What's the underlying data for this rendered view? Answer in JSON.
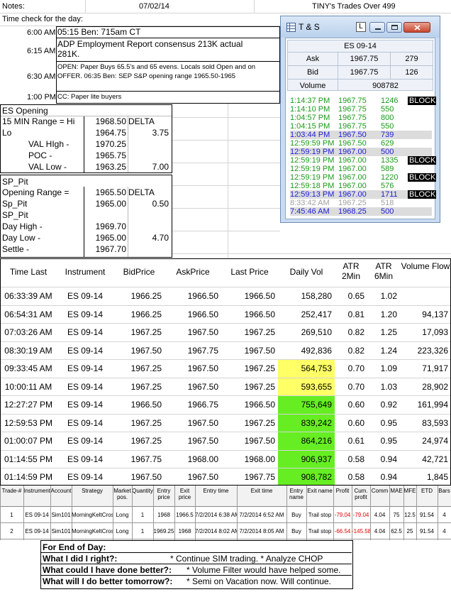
{
  "header": {
    "notes_label": "Notes:",
    "date": "07/02/14",
    "trades_title": "TINY's Trades Over 499"
  },
  "time_check": {
    "title": "Time check for the day:",
    "entries": [
      {
        "time": "6:00 AM",
        "text": "05:15 Ben: 715am CT"
      },
      {
        "time": "6:15 AM",
        "text": "ADP Employment Report consensus 213K actual 281K."
      },
      {
        "time": "6:30 AM",
        "text": "OPEN: Paper Buys 65.5's and 65 evens. Locals sold Open and on OFFER.  06:35 Ben: SEP S&P opening range 1965.50-1965"
      },
      {
        "time": "1:00 PM",
        "text": "CC: Paper lite buyers"
      }
    ]
  },
  "es_opening": {
    "title": "ES Opening",
    "rows": [
      {
        "label": "15 MIN Range = Hi",
        "value": "1968.50",
        "extra": "DELTA"
      },
      {
        "label": "Lo",
        "value": "1964.75",
        "extra": "3.75"
      },
      {
        "label": "VAL HIgh   -",
        "value": "1970.25",
        "extra": ""
      },
      {
        "label": "POC   -",
        "value": "1965.75",
        "extra": ""
      },
      {
        "label": "VAL Low   -",
        "value": "1963.25",
        "extra": "7.00"
      }
    ]
  },
  "sp_pit": {
    "rows": [
      {
        "label": "SP_Pit",
        "value": "",
        "extra": ""
      },
      {
        "label": "Opening Range =",
        "value": "1965.50",
        "extra": "DELTA"
      },
      {
        "label": "Sp_Pit",
        "value": "1965.00",
        "extra": "0.50"
      },
      {
        "label": "SP_Pit",
        "value": "",
        "extra": ""
      },
      {
        "label": "Day High -",
        "value": "1969.70",
        "extra": ""
      },
      {
        "label": "Day Low -",
        "value": "1965.00",
        "extra": "4.70"
      },
      {
        "label": "Settle -",
        "value": "1967.70",
        "extra": ""
      }
    ]
  },
  "ts_window": {
    "title": "T & S",
    "btn_l": "L",
    "instrument": "ES 09-14",
    "ask_label": "Ask",
    "ask_price": "1967.75",
    "ask_size": "279",
    "bid_label": "Bid",
    "bid_price": "1967.75",
    "bid_size": "126",
    "volume_label": "Volume",
    "volume": "908782",
    "colors": {
      "green": "#1a9a1a",
      "blue": "#1c1cd6",
      "gray": "#a0a0a0",
      "row_hl": "#dcdcdc"
    },
    "rows": [
      {
        "time": "1:14:37 PM",
        "price": "1967.75",
        "size": "1246",
        "block": "BLOCK",
        "color": "green",
        "hl": false
      },
      {
        "time": "1:14:10 PM",
        "price": "1967.75",
        "size": "550",
        "block": "",
        "color": "green",
        "hl": false
      },
      {
        "time": "1:04:57 PM",
        "price": "1967.75",
        "size": "800",
        "block": "",
        "color": "green",
        "hl": false
      },
      {
        "time": "1:04:15 PM",
        "price": "1967.75",
        "size": "550",
        "block": "",
        "color": "green",
        "hl": false
      },
      {
        "time": "1:03:44 PM",
        "price": "1967.50",
        "size": "739",
        "block": "",
        "color": "blue",
        "hl": true
      },
      {
        "time": "12:59:59 PM",
        "price": "1967.50",
        "size": "629",
        "block": "",
        "color": "green",
        "hl": false
      },
      {
        "time": "12:59:19 PM",
        "price": "1967.00",
        "size": "500",
        "block": "",
        "color": "blue",
        "hl": true
      },
      {
        "time": "12:59:19 PM",
        "price": "1967.00",
        "size": "1335",
        "block": "BLOCK",
        "color": "green",
        "hl": false
      },
      {
        "time": "12:59:19 PM",
        "price": "1967.00",
        "size": "589",
        "block": "",
        "color": "green",
        "hl": false
      },
      {
        "time": "12:59:19 PM",
        "price": "1967.00",
        "size": "1220",
        "block": "BLOCK",
        "color": "green",
        "hl": false
      },
      {
        "time": "12:59:18 PM",
        "price": "1967.00",
        "size": "576",
        "block": "",
        "color": "green",
        "hl": false
      },
      {
        "time": "12:59:13 PM",
        "price": "1967.00",
        "size": "1711",
        "block": "BLOCK",
        "color": "blue",
        "hl": true
      },
      {
        "time": "8:33:42 AM",
        "price": "1967.25",
        "size": "518",
        "block": "",
        "color": "gray",
        "hl": false
      },
      {
        "time": "7:45:46 AM",
        "price": "1968.25",
        "size": "500",
        "block": "",
        "color": "blue",
        "hl": true
      }
    ]
  },
  "market_table": {
    "headers": [
      "Time Last",
      "Instrument",
      "BidPrice",
      "AskPrice",
      "Last Price",
      "Daily Vol",
      "ATR 2Min",
      "ATR 6Min",
      "Volume Flow"
    ],
    "highlight_colors": {
      "yellow": "#ffff66",
      "green": "#66ee22"
    },
    "rows": [
      {
        "time": "06:33:39 AM",
        "inst": "ES 09-14",
        "bid": "1966.25",
        "ask": "1966.50",
        "last": "1966.50",
        "vol": "158,280",
        "atr2": "0.65",
        "atr6": "1.02",
        "flow": "",
        "hl": ""
      },
      {
        "time": "06:54:31 AM",
        "inst": "ES 09-14",
        "bid": "1966.25",
        "ask": "1966.50",
        "last": "1966.50",
        "vol": "252,417",
        "atr2": "0.81",
        "atr6": "1.20",
        "flow": "94,137",
        "hl": ""
      },
      {
        "time": "07:03:26 AM",
        "inst": "ES 09-14",
        "bid": "1967.25",
        "ask": "1967.50",
        "last": "1967.25",
        "vol": "269,510",
        "atr2": "0.82",
        "atr6": "1.25",
        "flow": "17,093",
        "hl": ""
      },
      {
        "time": "08:30:19 AM",
        "inst": "ES 09-14",
        "bid": "1967.50",
        "ask": "1967.75",
        "last": "1967.50",
        "vol": "492,836",
        "atr2": "0.82",
        "atr6": "1.24",
        "flow": "223,326",
        "hl": ""
      },
      {
        "time": "09:33:45 AM",
        "inst": "ES 09-14",
        "bid": "1967.25",
        "ask": "1967.50",
        "last": "1967.25",
        "vol": "564,753",
        "atr2": "0.70",
        "atr6": "1.09",
        "flow": "71,917",
        "hl": "yellow"
      },
      {
        "time": "10:00:11 AM",
        "inst": "ES 09-14",
        "bid": "1967.25",
        "ask": "1967.50",
        "last": "1967.25",
        "vol": "593,655",
        "atr2": "0.70",
        "atr6": "1.03",
        "flow": "28,902",
        "hl": "yellow"
      },
      {
        "time": "12:27:27 PM",
        "inst": "ES 09-14",
        "bid": "1966.50",
        "ask": "1966.75",
        "last": "1966.50",
        "vol": "755,649",
        "atr2": "0.60",
        "atr6": "0.92",
        "flow": "161,994",
        "hl": "green"
      },
      {
        "time": "12:59:53 PM",
        "inst": "ES 09-14",
        "bid": "1967.25",
        "ask": "1967.50",
        "last": "1967.25",
        "vol": "839,242",
        "atr2": "0.60",
        "atr6": "0.95",
        "flow": "83,593",
        "hl": "green"
      },
      {
        "time": "01:00:07 PM",
        "inst": "ES 09-14",
        "bid": "1967.25",
        "ask": "1967.50",
        "last": "1967.50",
        "vol": "864,216",
        "atr2": "0.61",
        "atr6": "0.95",
        "flow": "24,974",
        "hl": "green"
      },
      {
        "time": "01:14:55 PM",
        "inst": "ES 09-14",
        "bid": "1967.75",
        "ask": "1968.00",
        "last": "1968.00",
        "vol": "906,937",
        "atr2": "0.58",
        "atr6": "0.94",
        "flow": "42,721",
        "hl": "green"
      },
      {
        "time": "01:14:59 PM",
        "inst": "ES 09-14",
        "bid": "1967.50",
        "ask": "1967.50",
        "last": "1967.75",
        "vol": "908,782",
        "atr2": "0.58",
        "atr6": "0.94",
        "flow": "1,845",
        "hl": "green"
      }
    ]
  },
  "trades": {
    "headers": [
      "Trade-#",
      "Instrument",
      "Account",
      "Strategy",
      "Market pos.",
      "Quantity",
      "Entry price",
      "Exit price",
      "Entry time",
      "Exit time",
      "Entry name",
      "Exit name",
      "Profit",
      "Cum. profit",
      "Comm",
      "MAE",
      "MFE",
      "ETD",
      "Bars"
    ],
    "loss_color": "#dd0000",
    "rows": [
      [
        "1",
        "ES 09-14",
        "Sim101",
        "MorningKeltCross",
        "Long",
        "1",
        "1968",
        "1966.5",
        "7/2/2014 6:38 AM",
        "7/2/2014 6:52 AM",
        "Buy",
        "Trail stop",
        "-79.04",
        "-79.04",
        "4.04",
        "75",
        "12.5",
        "91.54",
        "4"
      ],
      [
        "2",
        "ES 09-14",
        "Sim101",
        "MorningKeltCross",
        "Long",
        "1",
        "1969.25",
        "1968",
        "7/2/2014 8:02 AM",
        "7/2/2014 8:05 AM",
        "Buy",
        "Trail stop",
        "-66.54",
        "-145.58",
        "4.04",
        "62.5",
        "25",
        "91.54",
        "4"
      ]
    ]
  },
  "summary": {
    "title": "For End of Day:",
    "lines": [
      {
        "q": "What I did I right?:",
        "a": "* Continue SIM trading.  * Analyze CHOP"
      },
      {
        "q": "What could I have done better?:",
        "a": "* Volume Filter would have helped some."
      },
      {
        "q": "What will I do better tomorrow?:",
        "a": "* Semi on Vacation now. Will continue."
      }
    ]
  }
}
